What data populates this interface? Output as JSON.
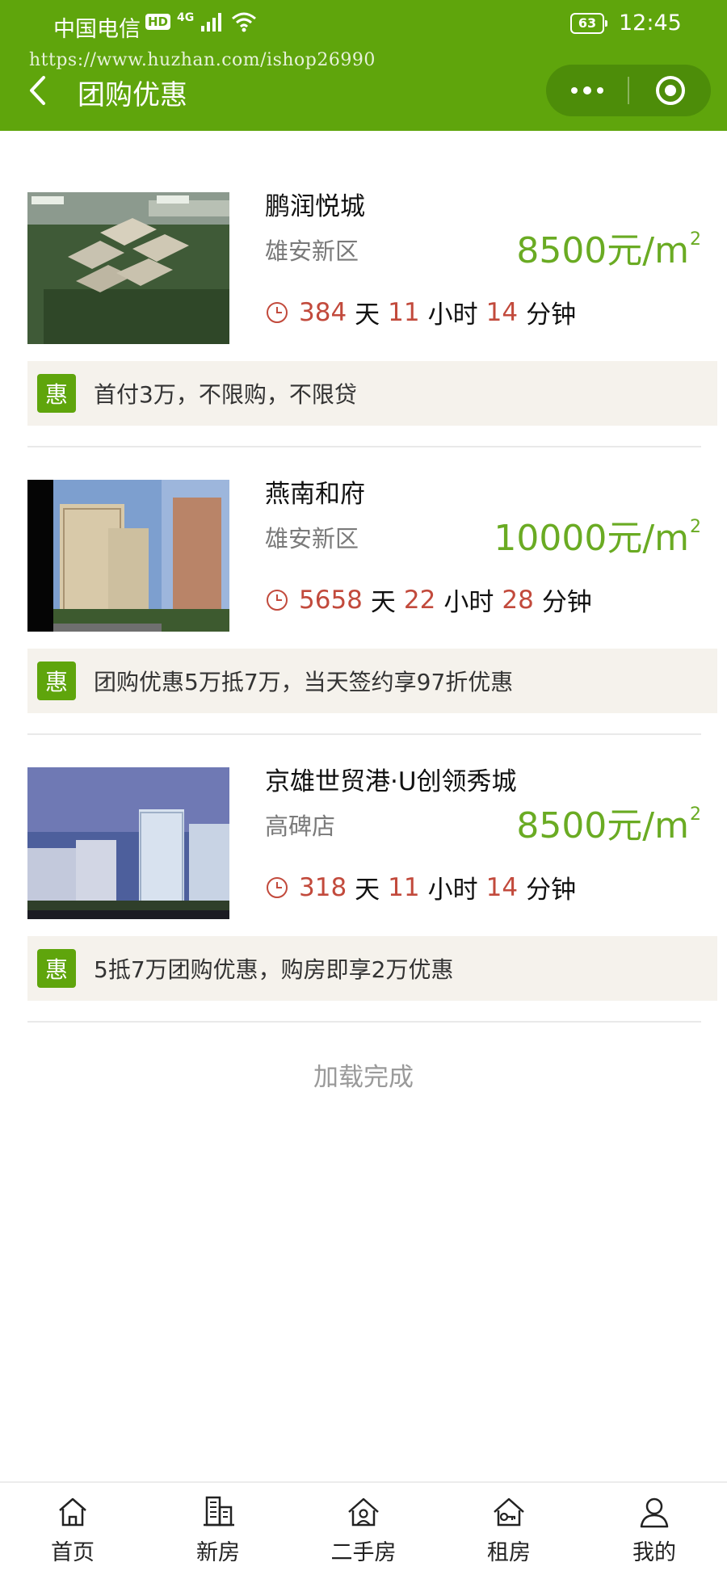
{
  "status_bar": {
    "carrier": "中国电信",
    "hd_badge": "HD",
    "network": "4G",
    "battery": "63",
    "time": "12:45"
  },
  "watermark": "https://www.huzhan.com/ishop26990",
  "nav": {
    "title": "团购优惠"
  },
  "listings": [
    {
      "name": "鹏润悦城",
      "area": "雄安新区",
      "price": "8500元/m",
      "price_sup": "2",
      "countdown": {
        "days": "384",
        "days_unit": "天",
        "hours": "11",
        "hours_unit": "小时",
        "minutes": "14",
        "minutes_unit": "分钟"
      },
      "promo_tag": "惠",
      "promo_text": "首付3万，不限购，不限贷"
    },
    {
      "name": "燕南和府",
      "area": "雄安新区",
      "price": "10000元/m",
      "price_sup": "2",
      "countdown": {
        "days": "5658",
        "days_unit": "天",
        "hours": "22",
        "hours_unit": "小时",
        "minutes": "28",
        "minutes_unit": "分钟"
      },
      "promo_tag": "惠",
      "promo_text": "团购优惠5万抵7万，当天签约享97折优惠"
    },
    {
      "name": "京雄世贸港·U创领秀城",
      "area": "高碑店",
      "price": "8500元/m",
      "price_sup": "2",
      "countdown": {
        "days": "318",
        "days_unit": "天",
        "hours": "11",
        "hours_unit": "小时",
        "minutes": "14",
        "minutes_unit": "分钟"
      },
      "promo_tag": "惠",
      "promo_text": "5抵7万团购优惠，购房即享2万优惠"
    }
  ],
  "load_status": "加载完成",
  "tabbar": [
    {
      "label": "首页",
      "icon": "home-icon"
    },
    {
      "label": "新房",
      "icon": "building-icon"
    },
    {
      "label": "二手房",
      "icon": "house-person-icon"
    },
    {
      "label": "租房",
      "icon": "house-key-icon"
    },
    {
      "label": "我的",
      "icon": "user-icon"
    }
  ],
  "colors": {
    "header_green": "#5fa50c",
    "price_green": "#6aab23",
    "countdown_red": "#c24a3c",
    "promo_bg": "#f5f2ec"
  }
}
